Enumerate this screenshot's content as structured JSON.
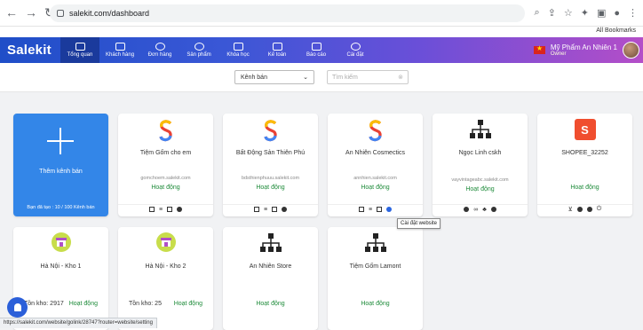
{
  "browser": {
    "url": "salekit.com/dashboard",
    "bookmarks_label": "All Bookmarks"
  },
  "brand": "Salekit",
  "menu": [
    {
      "label": "Tổng quan",
      "icon": "home-icon",
      "active": true
    },
    {
      "label": "Khách hàng",
      "icon": "users-icon"
    },
    {
      "label": "Đơn hàng",
      "icon": "dollar-icon"
    },
    {
      "label": "Sản phẩm",
      "icon": "product-icon"
    },
    {
      "label": "Khóa học",
      "icon": "book-icon"
    },
    {
      "label": "Kế toán",
      "icon": "accounting-icon"
    },
    {
      "label": "Báo cáo",
      "icon": "report-icon"
    },
    {
      "label": "Cài đặt",
      "icon": "settings-icon"
    }
  ],
  "user": {
    "name": "Mỹ Phẩm An Nhiên 1",
    "role": "Owner"
  },
  "filters": {
    "select_label": "Kênh bán",
    "search_placeholder": "Tìm kiếm"
  },
  "add_card": {
    "label": "Thêm kênh bán",
    "quota": "Bạn đã tạo : 10 / 100 Kênh bán"
  },
  "channels": [
    {
      "name": "Tiệm Gốm cho em",
      "sub": "gomchoem.salekit.com",
      "status": "Hoạt động",
      "logo": "salekit"
    },
    {
      "name": "Bất Động Sản Thiên Phú",
      "sub": "bdsthienphuuu.salekit.com",
      "status": "Hoạt động",
      "logo": "salekit"
    },
    {
      "name": "An Nhiên Cosmectics",
      "sub": "annhien.salekit.com",
      "status": "Hoạt động",
      "logo": "salekit"
    },
    {
      "name": "Ngọc Linh cskh",
      "sub": "vayvintageabc.salekit.com",
      "status": "Hoạt động",
      "logo": "hub"
    },
    {
      "name": "SHOPEE_32252",
      "sub": "",
      "status": "Hoạt động",
      "logo": "shopee"
    }
  ],
  "stores": [
    {
      "name": "Hà Nội - Kho 1",
      "stock": "Tồn kho: 2917",
      "status": "Hoạt động"
    },
    {
      "name": "Hà Nội - Kho 2",
      "stock": "Tồn kho: 25",
      "status": "Hoạt động"
    },
    {
      "name": "An Nhiên Store",
      "status": "Hoạt động"
    },
    {
      "name": "Tiệm Gốm Lamont",
      "status": "Hoạt động"
    }
  ],
  "tooltip": "Cài đặt website",
  "status_url": "https://salekit.com/website/golink/28747?router=website/setting"
}
